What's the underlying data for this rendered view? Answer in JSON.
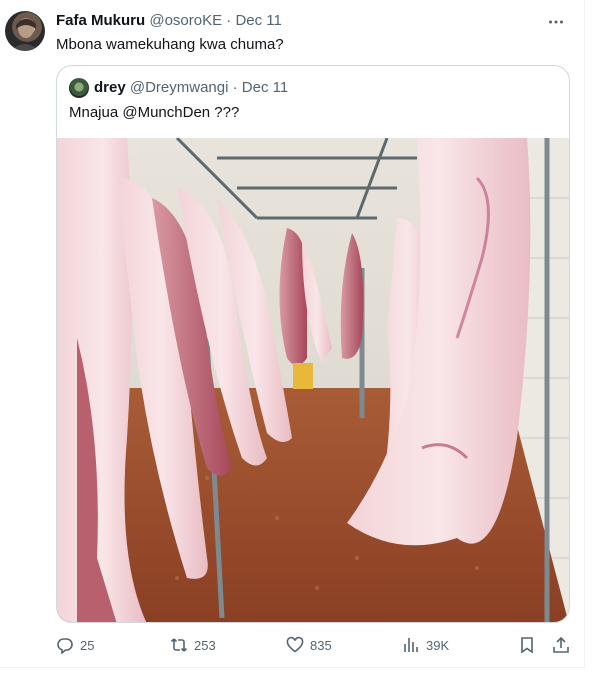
{
  "tweet": {
    "author_name": "Fafa Mukuru",
    "author_handle": "@osoroKE",
    "separator": "·",
    "date": "Dec 11",
    "text": "Mbona wamekuhang kwa chuma?",
    "avatar_icon": "user-avatar"
  },
  "quote": {
    "author_name": "drey",
    "author_handle": "@Dreymwangi",
    "separator": "·",
    "date": "Dec 11",
    "text": "Mnajua @MunchDen ???"
  },
  "actions": {
    "reply_count": "25",
    "retweet_count": "253",
    "like_count": "835",
    "views_count": "39K"
  },
  "colors": {
    "text_primary": "#0f1419",
    "text_secondary": "#536471",
    "border": "#cfd9de"
  }
}
